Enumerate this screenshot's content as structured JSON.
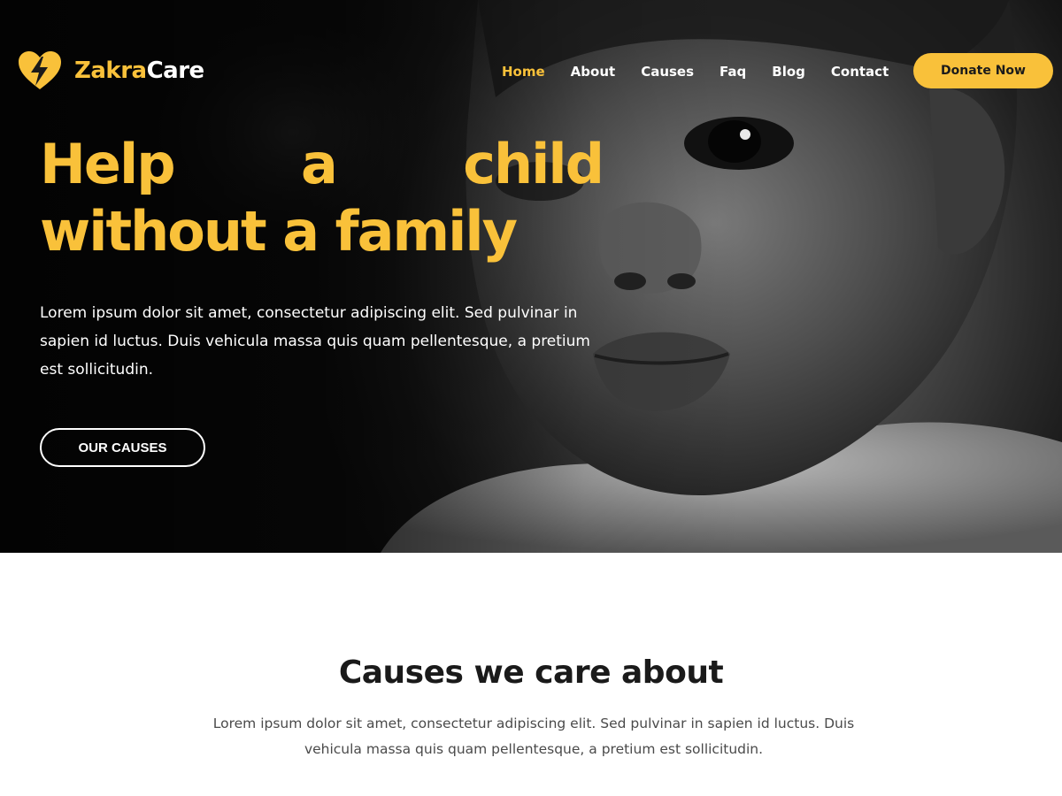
{
  "brand": {
    "name_part1": "Zakra",
    "name_part2": "Care",
    "logo_icon": "heart-bolt-icon",
    "accent_color": "#f9c13a"
  },
  "nav": {
    "items": [
      {
        "label": "Home",
        "active": true
      },
      {
        "label": "About",
        "active": false
      },
      {
        "label": "Causes",
        "active": false
      },
      {
        "label": "Faq",
        "active": false
      },
      {
        "label": "Blog",
        "active": false
      },
      {
        "label": "Contact",
        "active": false
      }
    ],
    "donate_label": "Donate Now"
  },
  "hero": {
    "title_words_line1": [
      "Help",
      "a",
      "child"
    ],
    "title_line2": "without a family",
    "description": "Lorem ipsum dolor sit amet, consectetur adipiscing elit. Sed pulvinar in sapien id luctus. Duis vehicula massa quis quam pellentesque, a pretium est sollicitudin.",
    "cta_label": "OUR CAUSES"
  },
  "causes_section": {
    "title": "Causes we care about",
    "description": "Lorem ipsum dolor sit amet, consectetur adipiscing elit. Sed pulvinar in sapien id luctus. Duis vehicula massa quis quam pellentesque, a pretium est sollicitudin."
  }
}
